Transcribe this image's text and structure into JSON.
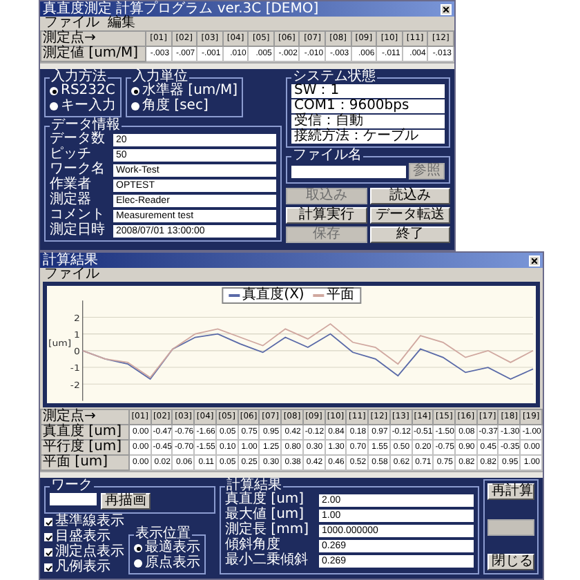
{
  "top_window": {
    "title": "真直度測定 計算プログラム ver.3C [DEMO]",
    "menu": [
      "ファイル",
      "編集"
    ],
    "table": {
      "corner": "測定点→",
      "columns": [
        "[01]",
        "[02]",
        "[03]",
        "[04]",
        "[05]",
        "[06]",
        "[07]",
        "[08]",
        "[09]",
        "[10]",
        "[11]",
        "[12]"
      ],
      "row_label": "測定値 [um/M]",
      "values": [
        "-.003",
        "-.007",
        "-.001",
        ".010",
        ".005",
        "-.002",
        "-.010",
        "-.003",
        ".006",
        "-.011",
        ".004",
        "-.013"
      ]
    },
    "input_method": {
      "title": "入力方法",
      "options": [
        {
          "label": "RS232C",
          "selected": true
        },
        {
          "label": "キー入力",
          "selected": false
        }
      ]
    },
    "input_unit": {
      "title": "入力単位",
      "options": [
        {
          "label": "水準器 [um/M]",
          "selected": true
        },
        {
          "label": "角度 [sec]",
          "selected": false
        }
      ]
    },
    "data_info": {
      "title": "データ情報",
      "fields": [
        {
          "label": "データ数",
          "value": "20"
        },
        {
          "label": "ピッチ",
          "value": "50"
        },
        {
          "label": "ワーク名",
          "value": "Work-Test"
        },
        {
          "label": "作業者",
          "value": "OPTEST"
        },
        {
          "label": "測定器",
          "value": "Elec-Reader"
        },
        {
          "label": "コメント",
          "value": "Measurement test"
        },
        {
          "label": "測定日時",
          "value": "2008/07/01 13:00:00"
        }
      ]
    },
    "system_status": {
      "title": "システム状態",
      "lines": [
        "SW：1",
        "COM1：9600bps",
        "受信：自動",
        "接続方法：ケーブル"
      ]
    },
    "file": {
      "title": "ファイル名",
      "button": {
        "label": "参照",
        "disabled": true
      }
    },
    "buttons": [
      {
        "label": "取込み",
        "disabled": true
      },
      {
        "label": "読込み",
        "disabled": false
      },
      {
        "label": "計算実行",
        "disabled": false
      },
      {
        "label": "データ転送",
        "disabled": false
      },
      {
        "label": "保存",
        "disabled": true
      },
      {
        "label": "終了",
        "disabled": false
      }
    ]
  },
  "result_window": {
    "title": "計算結果",
    "menu": [
      "ファイル"
    ],
    "chart_data": {
      "type": "line",
      "ylabel": "[um]",
      "ylim": [
        -3,
        3
      ],
      "yticks": [
        -2,
        -1,
        0,
        1,
        2
      ],
      "grid": true,
      "series": [
        {
          "name": "真直度(X)",
          "color": "#5a6aa8",
          "values": [
            0,
            -0.5,
            -0.8,
            -1.7,
            0.1,
            0.8,
            1.0,
            0.4,
            -0.1,
            0.8,
            0.2,
            1.0,
            -0.1,
            -0.5,
            -1.5,
            0.1,
            -0.4,
            -1.3,
            -1.0,
            -1.7,
            -1.1
          ]
        },
        {
          "name": "平面",
          "color": "#d0a8a0",
          "values": [
            0,
            -0.5,
            -0.7,
            -1.6,
            0.1,
            1.0,
            1.3,
            0.8,
            0.3,
            1.3,
            0.7,
            1.6,
            0.5,
            0.2,
            -0.8,
            0.9,
            0.5,
            -0.4,
            0.0,
            -0.7,
            0.0
          ]
        }
      ]
    },
    "table": {
      "corner": "測定点→",
      "columns": [
        "[01]",
        "[02]",
        "[03]",
        "[04]",
        "[05]",
        "[06]",
        "[07]",
        "[08]",
        "[09]",
        "[10]",
        "[11]",
        "[12]",
        "[13]",
        "[14]",
        "[15]",
        "[16]",
        "[17]",
        "[18]",
        "[19]"
      ],
      "rows": [
        {
          "label": "真直度 [um]",
          "values": [
            "0.00",
            "-0.47",
            "-0.76",
            "-1.66",
            "0.05",
            "0.75",
            "0.95",
            "0.42",
            "-0.12",
            "0.84",
            "0.18",
            "0.97",
            "-0.12",
            "-0.51",
            "-1.50",
            "0.08",
            "-0.37",
            "-1.30",
            "-1.00"
          ]
        },
        {
          "label": "平行度 [um]",
          "values": [
            "0.00",
            "-0.45",
            "-0.70",
            "-1.55",
            "0.10",
            "1.00",
            "1.25",
            "0.80",
            "0.30",
            "1.30",
            "0.70",
            "1.55",
            "0.50",
            "0.20",
            "-0.75",
            "0.90",
            "0.45",
            "-0.35",
            "0.00"
          ]
        },
        {
          "label": "平面 [um]",
          "values": [
            "0.00",
            "0.02",
            "0.06",
            "0.11",
            "0.05",
            "0.25",
            "0.30",
            "0.38",
            "0.42",
            "0.46",
            "0.52",
            "0.58",
            "0.62",
            "0.71",
            "0.75",
            "0.82",
            "0.82",
            "0.95",
            "1.00"
          ]
        }
      ]
    },
    "redraw": {
      "title": "ワーク",
      "button": "再描画"
    },
    "checkboxes": [
      {
        "label": "基準線表示",
        "checked": true
      },
      {
        "label": "目盛表示",
        "checked": true
      },
      {
        "label": "測定点表示",
        "checked": true
      },
      {
        "label": "凡例表示",
        "checked": true
      }
    ],
    "display_position": {
      "title": "表示位置",
      "options": [
        {
          "label": "最適表示",
          "selected": true
        },
        {
          "label": "原点表示",
          "selected": false
        }
      ]
    },
    "results": {
      "title": "計算結果",
      "fields": [
        {
          "label": "真直度 [um]",
          "value": "2.00"
        },
        {
          "label": "最大値 [um]",
          "value": "1.00"
        },
        {
          "label": "測定長 [mm]",
          "value": "1000.000000"
        },
        {
          "label": "傾斜角度",
          "value": "0.269"
        },
        {
          "label": "最小二乗傾斜",
          "value": "0.269"
        }
      ]
    },
    "side_buttons": [
      {
        "label": "再計算",
        "disabled": false
      },
      {
        "disabled": true
      },
      {
        "label": "閉じる",
        "disabled": false
      }
    ]
  }
}
